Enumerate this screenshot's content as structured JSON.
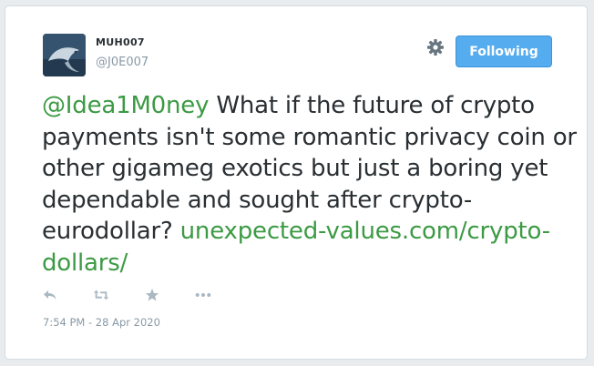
{
  "author": {
    "name": "MUH007",
    "handle": "@J0E007"
  },
  "follow_button": {
    "label": "Following"
  },
  "tweet": {
    "mention": "@Idea1M0ney",
    "text": " What if the future of crypto payments isn't some romantic privacy coin or other gigameg exotics but just a boring yet dependable and sought after crypto-eurodollar? ",
    "link": "unexpected-values.com/crypto-dollars/"
  },
  "timestamp": "7:54 PM - 28 Apr 2020",
  "icons": {
    "settings": "gear-icon",
    "reply": "reply-icon",
    "retweet": "retweet-icon",
    "like": "star-icon",
    "more": "more-icon"
  },
  "colors": {
    "follow_button": "#55acee",
    "link": "#3c9a44",
    "text": "#292f33",
    "muted": "#8899a6"
  }
}
